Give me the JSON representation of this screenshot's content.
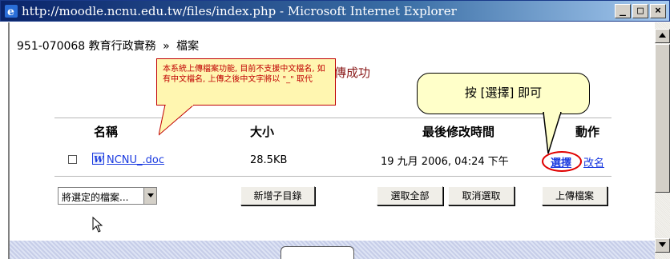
{
  "window": {
    "title": "http://moodle.ncnu.edu.tw/files/index.php - Microsoft Internet Explorer",
    "minimize": "_",
    "maximize": "□",
    "close": "×"
  },
  "breadcrumb": {
    "course": "951-070068 教育行政實務",
    "separator": "»",
    "current": "檔案"
  },
  "upload_message": "上傳成功",
  "table": {
    "headers": {
      "name": "名稱",
      "size": "大小",
      "modified": "最後修改時間",
      "action": "動作"
    },
    "rows": [
      {
        "filename": "NCNU_.doc",
        "size": "28.5KB",
        "modified": "19 九月 2006, 04:24 下午",
        "action_choose": "選擇",
        "action_rename": "改名"
      }
    ]
  },
  "toolbar": {
    "selected_files_select": "將選定的檔案...",
    "new_folder_button": "新增子目錄",
    "select_all_button": "選取全部",
    "deselect_button": "取消選取",
    "upload_button": "上傳檔案"
  },
  "callouts": {
    "note": "本系統上傳檔案功能, 目前不支援中文檔名, 如有中文檔名, 上傳之後中文字將以 \"_\" 取代",
    "hint": "按 [選擇] 即可"
  },
  "colors": {
    "titlebar": "#0a246a",
    "callout_note_border": "#c00000",
    "link": "#1a3ae0",
    "highlight_circle": "#e00000"
  }
}
